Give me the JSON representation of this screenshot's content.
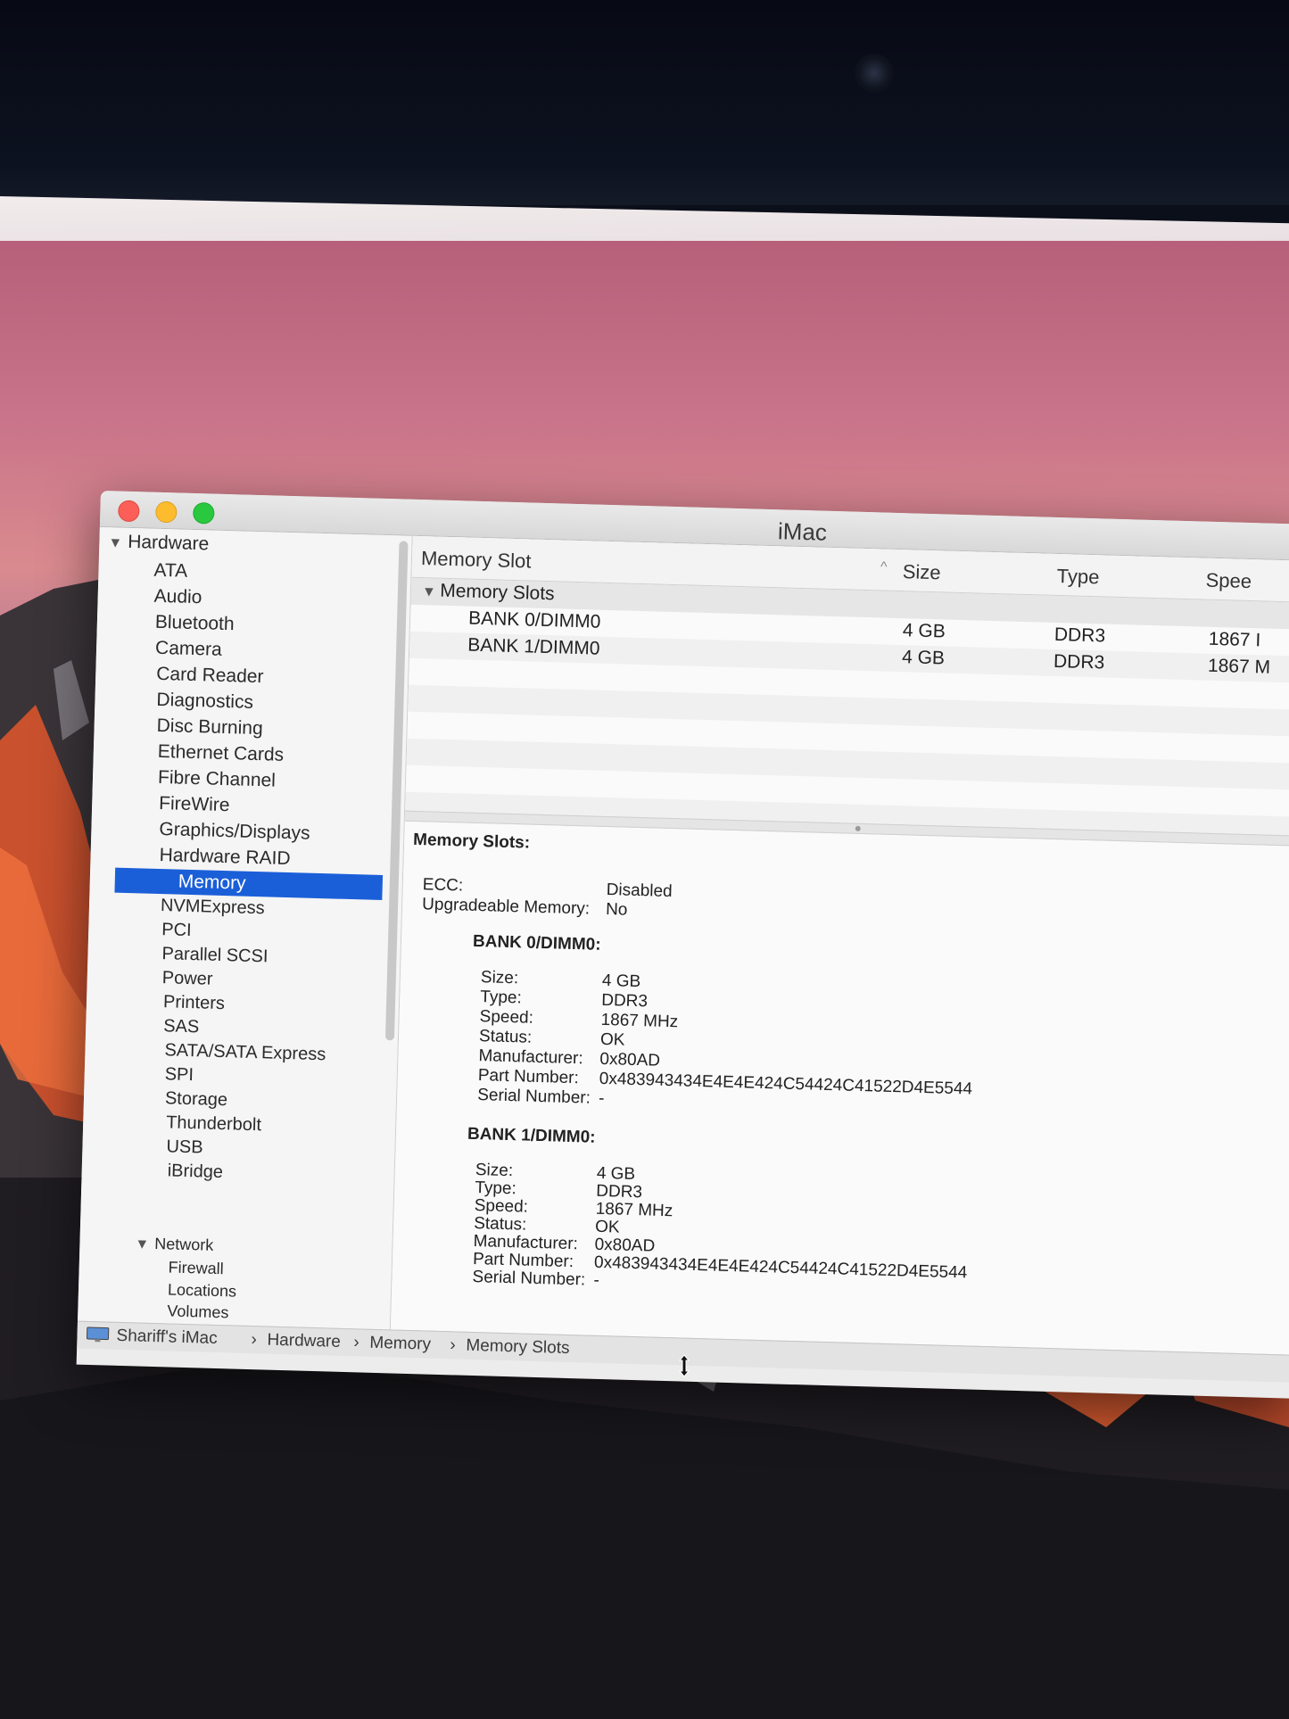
{
  "window": {
    "title": "iMac"
  },
  "sidebar": {
    "groups": [
      {
        "label": "Hardware"
      },
      {
        "label": "Network"
      }
    ],
    "items": [
      "ATA",
      "Audio",
      "Bluetooth",
      "Camera",
      "Card Reader",
      "Diagnostics",
      "Disc Burning",
      "Ethernet Cards",
      "Fibre Channel",
      "FireWire",
      "Graphics/Displays",
      "Hardware RAID",
      "Memory",
      "NVMExpress",
      "PCI",
      "Parallel SCSI",
      "Power",
      "Printers",
      "SAS",
      "SATA/SATA Express",
      "SPI",
      "Storage",
      "Thunderbolt",
      "USB",
      "iBridge"
    ],
    "selected": "Memory",
    "network_items": [
      "Firewall",
      "Locations",
      "Volumes"
    ]
  },
  "table": {
    "columns": [
      "Memory Slot",
      "Size",
      "Type",
      "Spee"
    ],
    "group_label": "Memory Slots",
    "rows": [
      {
        "slot": "BANK 0/DIMM0",
        "size": "4 GB",
        "type": "DDR3",
        "speed": "1867 I"
      },
      {
        "slot": "BANK 1/DIMM0",
        "size": "4 GB",
        "type": "DDR3",
        "speed": "1867 M"
      }
    ]
  },
  "detail": {
    "heading": "Memory Slots:",
    "ecc_label": "ECC:",
    "ecc_value": "Disabled",
    "upgradeable_label": "Upgradeable Memory:",
    "upgradeable_value": "No",
    "banks": [
      {
        "title": "BANK 0/DIMM0:",
        "size": "4 GB",
        "type": "DDR3",
        "speed": "1867 MHz",
        "status": "OK",
        "manufacturer": "0x80AD",
        "part_number": "0x483943434E4E4E424C54424C41522D4E5544",
        "serial_number": "-"
      },
      {
        "title": "BANK 1/DIMM0:",
        "size": "4 GB",
        "type": "DDR3",
        "speed": "1867 MHz",
        "status": "OK",
        "manufacturer": "0x80AD",
        "part_number": "0x483943434E4E4E424C54424C41522D4E5544",
        "serial_number": "-"
      }
    ],
    "labels": {
      "size": "Size:",
      "type": "Type:",
      "speed": "Speed:",
      "status": "Status:",
      "manufacturer": "Manufacturer:",
      "part_number": "Part Number:",
      "serial_number": "Serial Number:"
    }
  },
  "statusbar": {
    "path": [
      "Shariff's iMac",
      "Hardware",
      "Memory",
      "Memory Slots"
    ],
    "separator": "›"
  },
  "colors": {
    "selection": "#1b5fd8",
    "close": "#fc5f57",
    "minimize": "#fdbc2e",
    "zoom": "#29c83f"
  }
}
